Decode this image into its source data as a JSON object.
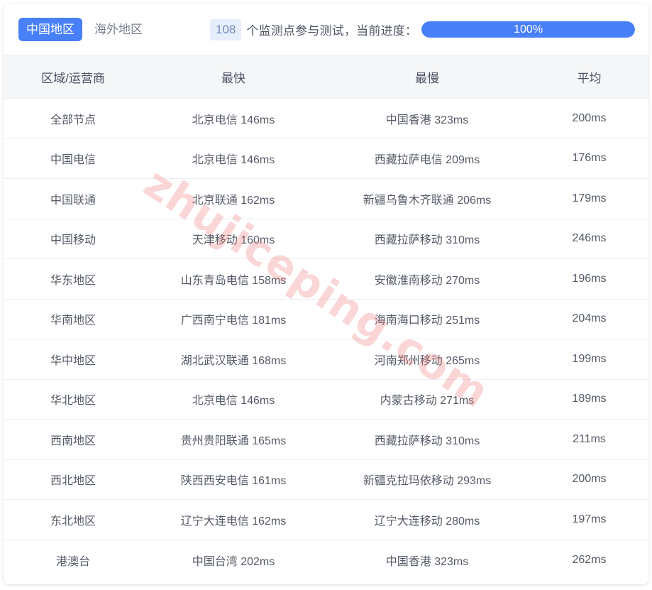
{
  "toolbar": {
    "tabs": [
      {
        "label": "中国地区",
        "active": true
      },
      {
        "label": "海外地区",
        "active": false
      }
    ],
    "count": "108",
    "progress_text": "个监测点参与测试，当前进度：",
    "progress_percent_label": "100%",
    "progress_percent_value": 100,
    "accent_color": "#4880f7",
    "badge_bg_color": "#e7eefb"
  },
  "watermark": {
    "text": "zhujiceping.com",
    "color": "#f07678"
  },
  "table": {
    "columns": [
      "区域/运营商",
      "最快",
      "最慢",
      "平均"
    ],
    "rows": [
      {
        "region": "全部节点",
        "fastest": "北京电信 146ms",
        "slowest": "中国香港 323ms",
        "average": "200ms"
      },
      {
        "region": "中国电信",
        "fastest": "北京电信 146ms",
        "slowest": "西藏拉萨电信 209ms",
        "average": "176ms"
      },
      {
        "region": "中国联通",
        "fastest": "北京联通 162ms",
        "slowest": "新疆乌鲁木齐联通 206ms",
        "average": "179ms"
      },
      {
        "region": "中国移动",
        "fastest": "天津移动 160ms",
        "slowest": "西藏拉萨移动 310ms",
        "average": "246ms"
      },
      {
        "region": "华东地区",
        "fastest": "山东青岛电信 158ms",
        "slowest": "安徽淮南移动 270ms",
        "average": "196ms"
      },
      {
        "region": "华南地区",
        "fastest": "广西南宁电信 181ms",
        "slowest": "海南海口移动 251ms",
        "average": "204ms"
      },
      {
        "region": "华中地区",
        "fastest": "湖北武汉联通 168ms",
        "slowest": "河南郑州移动 265ms",
        "average": "199ms"
      },
      {
        "region": "华北地区",
        "fastest": "北京电信 146ms",
        "slowest": "内蒙古移动 271ms",
        "average": "189ms"
      },
      {
        "region": "西南地区",
        "fastest": "贵州贵阳联通 165ms",
        "slowest": "西藏拉萨移动 310ms",
        "average": "211ms"
      },
      {
        "region": "西北地区",
        "fastest": "陕西西安电信 161ms",
        "slowest": "新疆克拉玛依移动 293ms",
        "average": "200ms"
      },
      {
        "region": "东北地区",
        "fastest": "辽宁大连电信 162ms",
        "slowest": "辽宁大连移动 280ms",
        "average": "197ms"
      },
      {
        "region": "港澳台",
        "fastest": "中国台湾 202ms",
        "slowest": "中国香港 323ms",
        "average": "262ms"
      }
    ]
  }
}
